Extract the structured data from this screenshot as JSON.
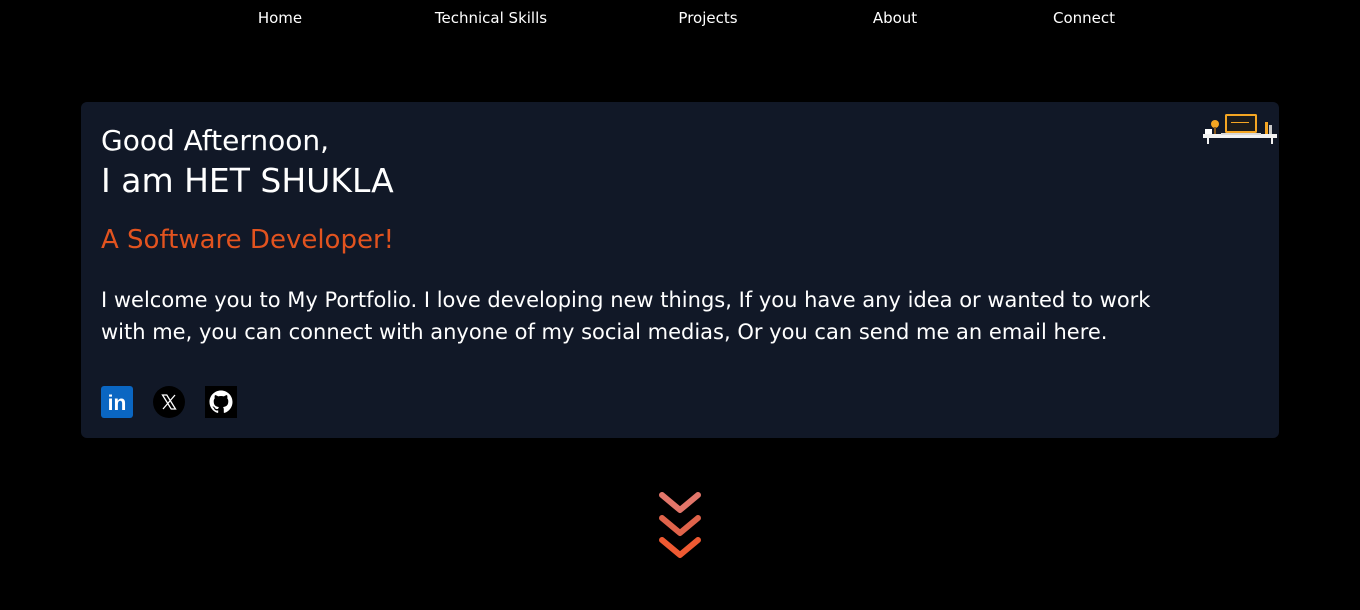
{
  "nav": {
    "items": [
      "Home",
      "Technical Skills",
      "Projects",
      "About",
      "Connect"
    ]
  },
  "hero": {
    "greeting": "Good Afternoon,",
    "name": "I am HET SHUKLA",
    "role": "A Software Developer!",
    "intro": "I welcome you to My Portfolio. I love developing new things, If you have any idea or wanted to work with me, you can connect with anyone of my social medias, Or you can send me an email here."
  },
  "socials": [
    {
      "icon": "linkedin-icon",
      "label": "in"
    },
    {
      "icon": "x-twitter-icon"
    },
    {
      "icon": "github-icon"
    }
  ],
  "colors": {
    "background": "#000000",
    "card": "#111827",
    "accent": "#e2531f",
    "text": "#ffffff",
    "linkedin": "#0a66c2"
  }
}
